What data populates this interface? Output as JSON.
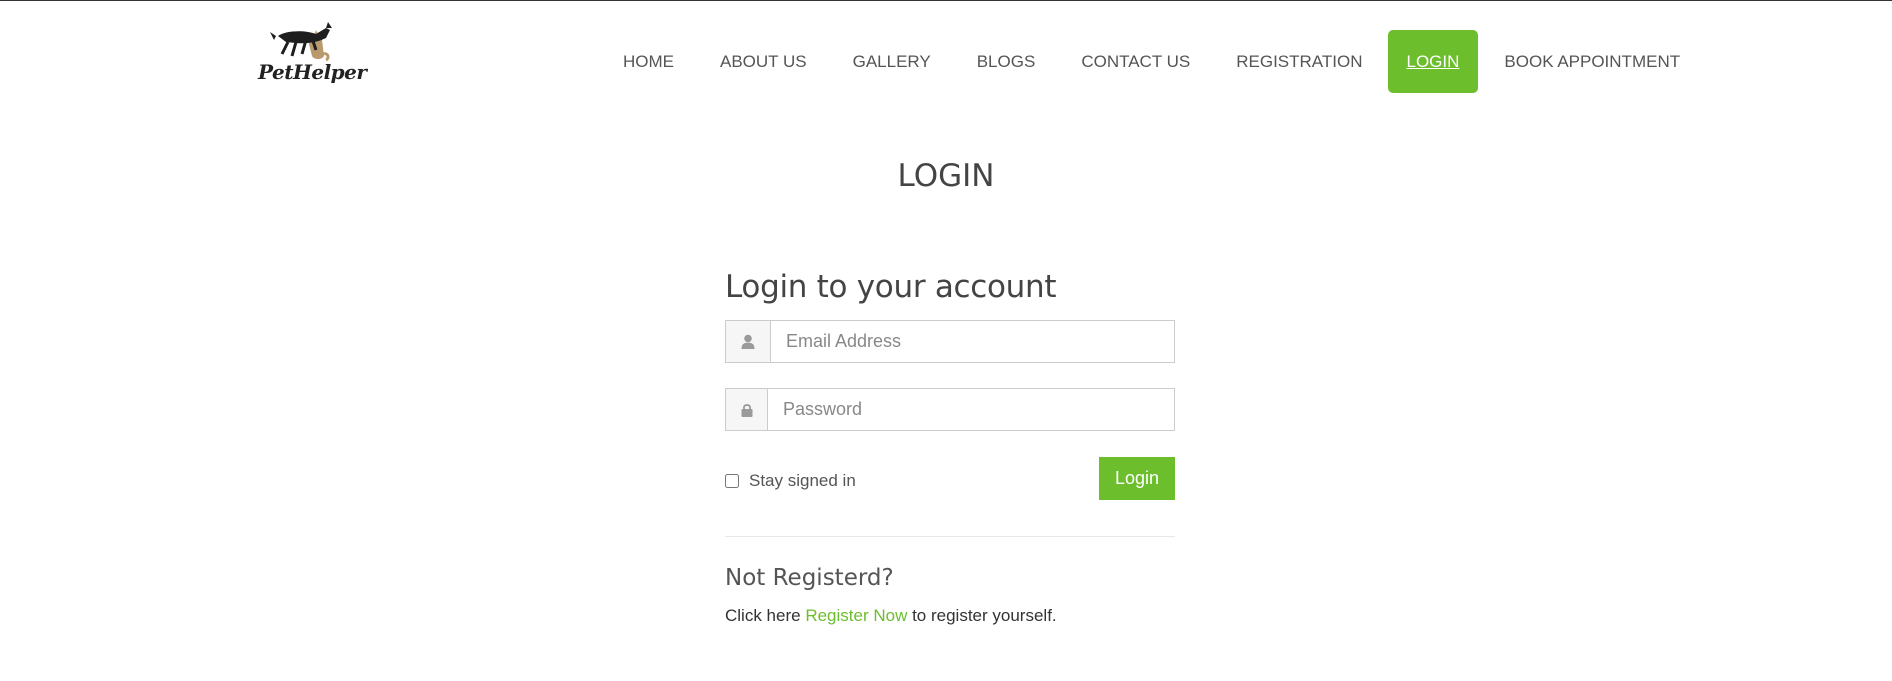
{
  "header": {
    "logo_text": "PetHelper",
    "nav": [
      {
        "label": "HOME"
      },
      {
        "label": "ABOUT US"
      },
      {
        "label": "GALLERY"
      },
      {
        "label": "BLOGS"
      },
      {
        "label": "CONTACT US"
      },
      {
        "label": "REGISTRATION"
      },
      {
        "label": "LOGIN",
        "active": true
      },
      {
        "label": "BOOK APPOINTMENT"
      }
    ]
  },
  "page": {
    "title": "LOGIN"
  },
  "login": {
    "heading": "Login to your account",
    "email": {
      "placeholder": "Email Address",
      "value": ""
    },
    "password": {
      "placeholder": "Password",
      "value": ""
    },
    "remember_label": "Stay signed in",
    "remember_checked": false,
    "submit_label": "Login",
    "not_registered_heading": "Not Registerd?",
    "register_prefix": "Click here ",
    "register_link": "Register Now",
    "register_suffix": " to register yourself."
  },
  "icons": {
    "email": "user-icon",
    "password": "lock-icon"
  },
  "colors": {
    "accent": "#6dbe2d",
    "text": "#555555",
    "heading": "#444444"
  }
}
